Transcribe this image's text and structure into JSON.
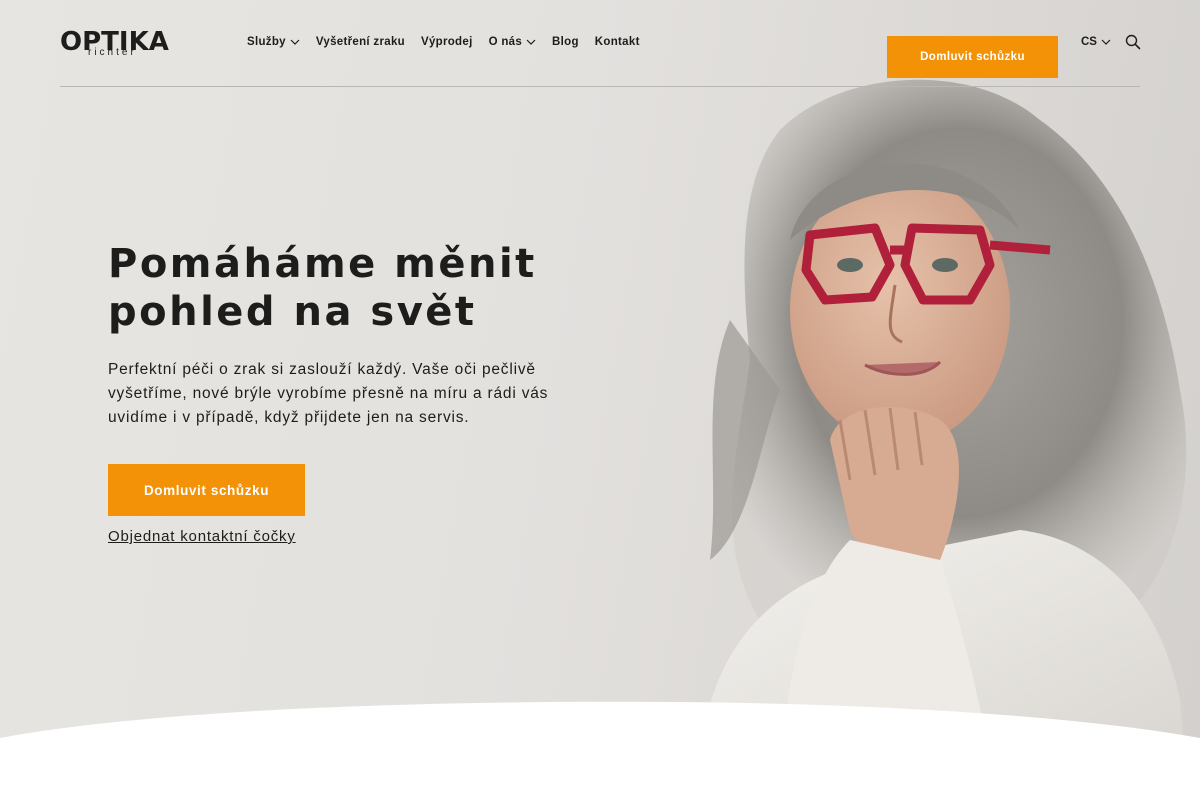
{
  "brand": {
    "logo_main": "OPTIKA",
    "logo_sub": "richter",
    "accent_color": "#f39207",
    "text_color": "#1d1d1b"
  },
  "nav": {
    "items": [
      {
        "label": "Služby",
        "has_dropdown": true
      },
      {
        "label": "Vyšetření zraku",
        "has_dropdown": false
      },
      {
        "label": "Výprodej",
        "has_dropdown": false
      },
      {
        "label": "O nás",
        "has_dropdown": true
      },
      {
        "label": "Blog",
        "has_dropdown": false
      },
      {
        "label": "Kontakt",
        "has_dropdown": false
      }
    ],
    "cta_label": "Domluvit schůzku",
    "language": "CS",
    "search_icon": "search-icon"
  },
  "hero": {
    "headline": "Pomáháme měnit pohled na svět",
    "lead": "Perfektní péči o zrak si zaslouží každý. Vaše oči pečlivě vyšetříme, nové brýle vyrobíme přesně na míru a rádi vás uvidíme i v případě, když přijdete jen na servis.",
    "cta_label": "Domluvit schůzku",
    "secondary_link": "Objednat kontaktní čočky"
  }
}
